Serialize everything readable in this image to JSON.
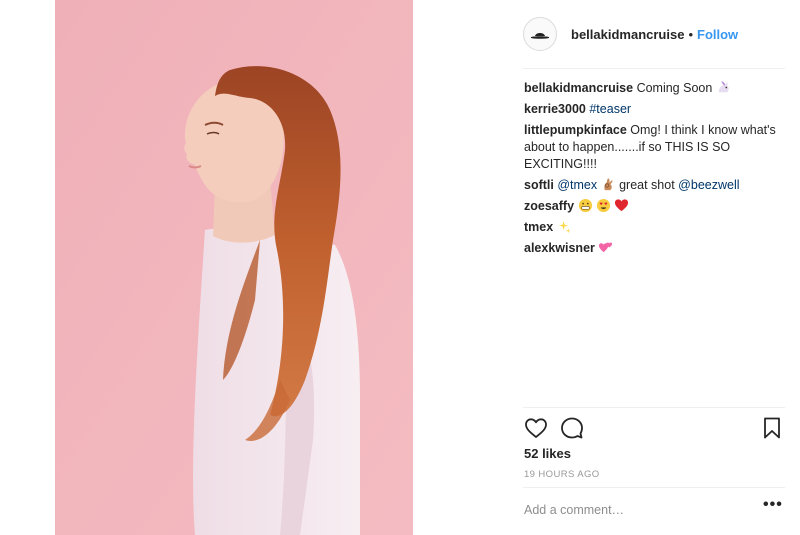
{
  "post": {
    "image_alt": "Profile portrait of a woman with long red hair in a pale pink t-shirt against a pink background"
  },
  "header": {
    "username": "bellakidmancruise",
    "separator": "•",
    "follow_label": "Follow",
    "avatar_icon": "hat-logo-icon"
  },
  "comments": [
    {
      "user": "bellakidmancruise",
      "text": "Coming Soon",
      "emoji": "unicorn-emoji"
    },
    {
      "user": "kerrie3000",
      "hashtag": "#teaser"
    },
    {
      "user": "littlepumpkinface",
      "text": "Omg! I think I know what's about to happen.......if so THIS IS SO EXCITING!!!!"
    },
    {
      "user": "softli",
      "mention1": "@tmex",
      "text": "great shot",
      "mention2": "@beezwell",
      "emoji": "ok-hand-emoji"
    },
    {
      "user": "zoesaffy",
      "emojis": [
        "grimacing-emoji",
        "heart-eyes-emoji",
        "red-heart-emoji"
      ]
    },
    {
      "user": "tmex",
      "emoji": "sparkles-emoji"
    },
    {
      "user": "alexkwisner",
      "emoji": "two-hearts-emoji"
    }
  ],
  "actions": {
    "like_icon": "heart-outline-icon",
    "comment_icon": "speech-bubble-icon",
    "save_icon": "bookmark-icon"
  },
  "likes": "52 likes",
  "timestamp": "19 HOURS AGO",
  "add_comment": {
    "placeholder": "Add a comment…",
    "value": ""
  },
  "more_label": "•••",
  "colors": {
    "follow_blue": "#3897f0",
    "link_blue": "#003569",
    "pink_background": "#f1b3bb",
    "hair": "#b5562d"
  }
}
